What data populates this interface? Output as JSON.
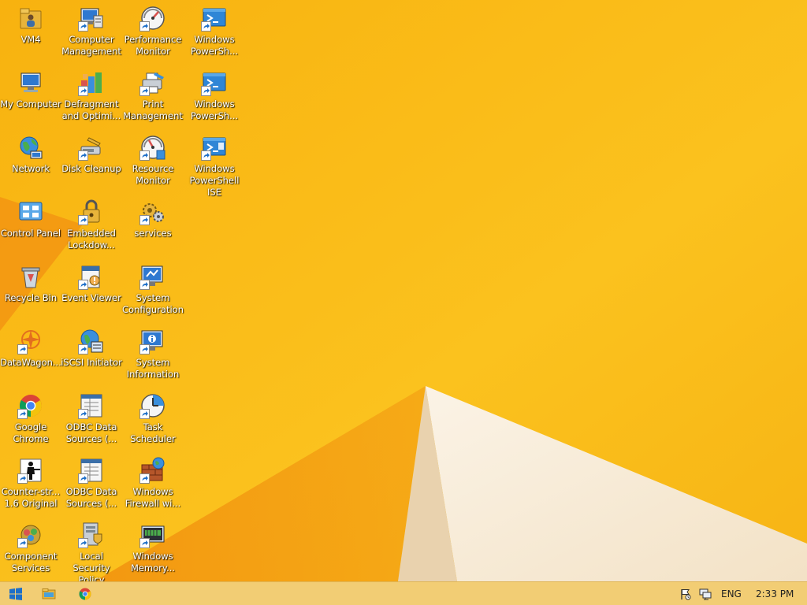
{
  "desktop": {
    "icons": [
      {
        "label": "VM4",
        "icon": "folder-user-icon",
        "shortcut": false
      },
      {
        "label": "My Computer",
        "icon": "computer-icon",
        "shortcut": false
      },
      {
        "label": "Network",
        "icon": "network-globe-icon",
        "shortcut": false
      },
      {
        "label": "Control Panel",
        "icon": "control-panel-icon",
        "shortcut": false
      },
      {
        "label": "Recycle Bin",
        "icon": "recycle-bin-icon",
        "shortcut": false
      },
      {
        "label": "DataWagon...",
        "icon": "datawagon-icon",
        "shortcut": true
      },
      {
        "label": "Google\nChrome",
        "icon": "chrome-icon",
        "shortcut": true
      },
      {
        "label": "Counter-str...\n1.6 Original",
        "icon": "counter-strike-icon",
        "shortcut": true
      },
      {
        "label": "Component\nServices",
        "icon": "component-services-icon",
        "shortcut": true
      },
      {
        "label": "Computer\nManagement",
        "icon": "computer-management-icon",
        "shortcut": true
      },
      {
        "label": "Defragment\nand Optimi...",
        "icon": "defragment-icon",
        "shortcut": true
      },
      {
        "label": "Disk Cleanup",
        "icon": "disk-cleanup-icon",
        "shortcut": true
      },
      {
        "label": "Embedded\nLockdow...",
        "icon": "lockdown-icon",
        "shortcut": true
      },
      {
        "label": "Event Viewer",
        "icon": "event-viewer-icon",
        "shortcut": true
      },
      {
        "label": "iSCSI Initiator",
        "icon": "iscsi-icon",
        "shortcut": true
      },
      {
        "label": "ODBC Data\nSources (...",
        "icon": "odbc-icon",
        "shortcut": true
      },
      {
        "label": "ODBC Data\nSources (...",
        "icon": "odbc-icon",
        "shortcut": true
      },
      {
        "label": "Local Security\nPolicy",
        "icon": "security-policy-icon",
        "shortcut": true
      },
      {
        "label": "Performance\nMonitor",
        "icon": "performance-monitor-icon",
        "shortcut": true
      },
      {
        "label": "Print\nManagement",
        "icon": "print-management-icon",
        "shortcut": true
      },
      {
        "label": "Resource\nMonitor",
        "icon": "resource-monitor-icon",
        "shortcut": true
      },
      {
        "label": "services",
        "icon": "services-gear-icon",
        "shortcut": true
      },
      {
        "label": "System\nConfiguration",
        "icon": "system-configuration-icon",
        "shortcut": true
      },
      {
        "label": "System\nInformation",
        "icon": "system-information-icon",
        "shortcut": true
      },
      {
        "label": "Task\nScheduler",
        "icon": "task-scheduler-icon",
        "shortcut": true
      },
      {
        "label": "Windows\nFirewall wi...",
        "icon": "firewall-icon",
        "shortcut": true
      },
      {
        "label": "Windows\nMemory...",
        "icon": "memory-diagnostic-icon",
        "shortcut": true
      },
      {
        "label": "Windows\nPowerSh...",
        "icon": "powershell-icon",
        "shortcut": true
      },
      {
        "label": "Windows\nPowerSh...",
        "icon": "powershell-icon",
        "shortcut": true
      },
      {
        "label": "Windows\nPowerShell\nISE",
        "icon": "powershell-ise-icon",
        "shortcut": true
      }
    ]
  },
  "taskbar": {
    "start_icon": "windows-start-icon",
    "pinned": [
      {
        "icon": "file-explorer-icon"
      },
      {
        "icon": "chrome-icon"
      }
    ],
    "tray": {
      "flag_icon": "action-center-flag-icon",
      "network_icon": "network-tray-icon",
      "language": "ENG",
      "clock": "2:33 PM"
    }
  },
  "colors": {
    "wallpaper_base": "#F9BA16",
    "taskbar": "#F2CD74"
  }
}
